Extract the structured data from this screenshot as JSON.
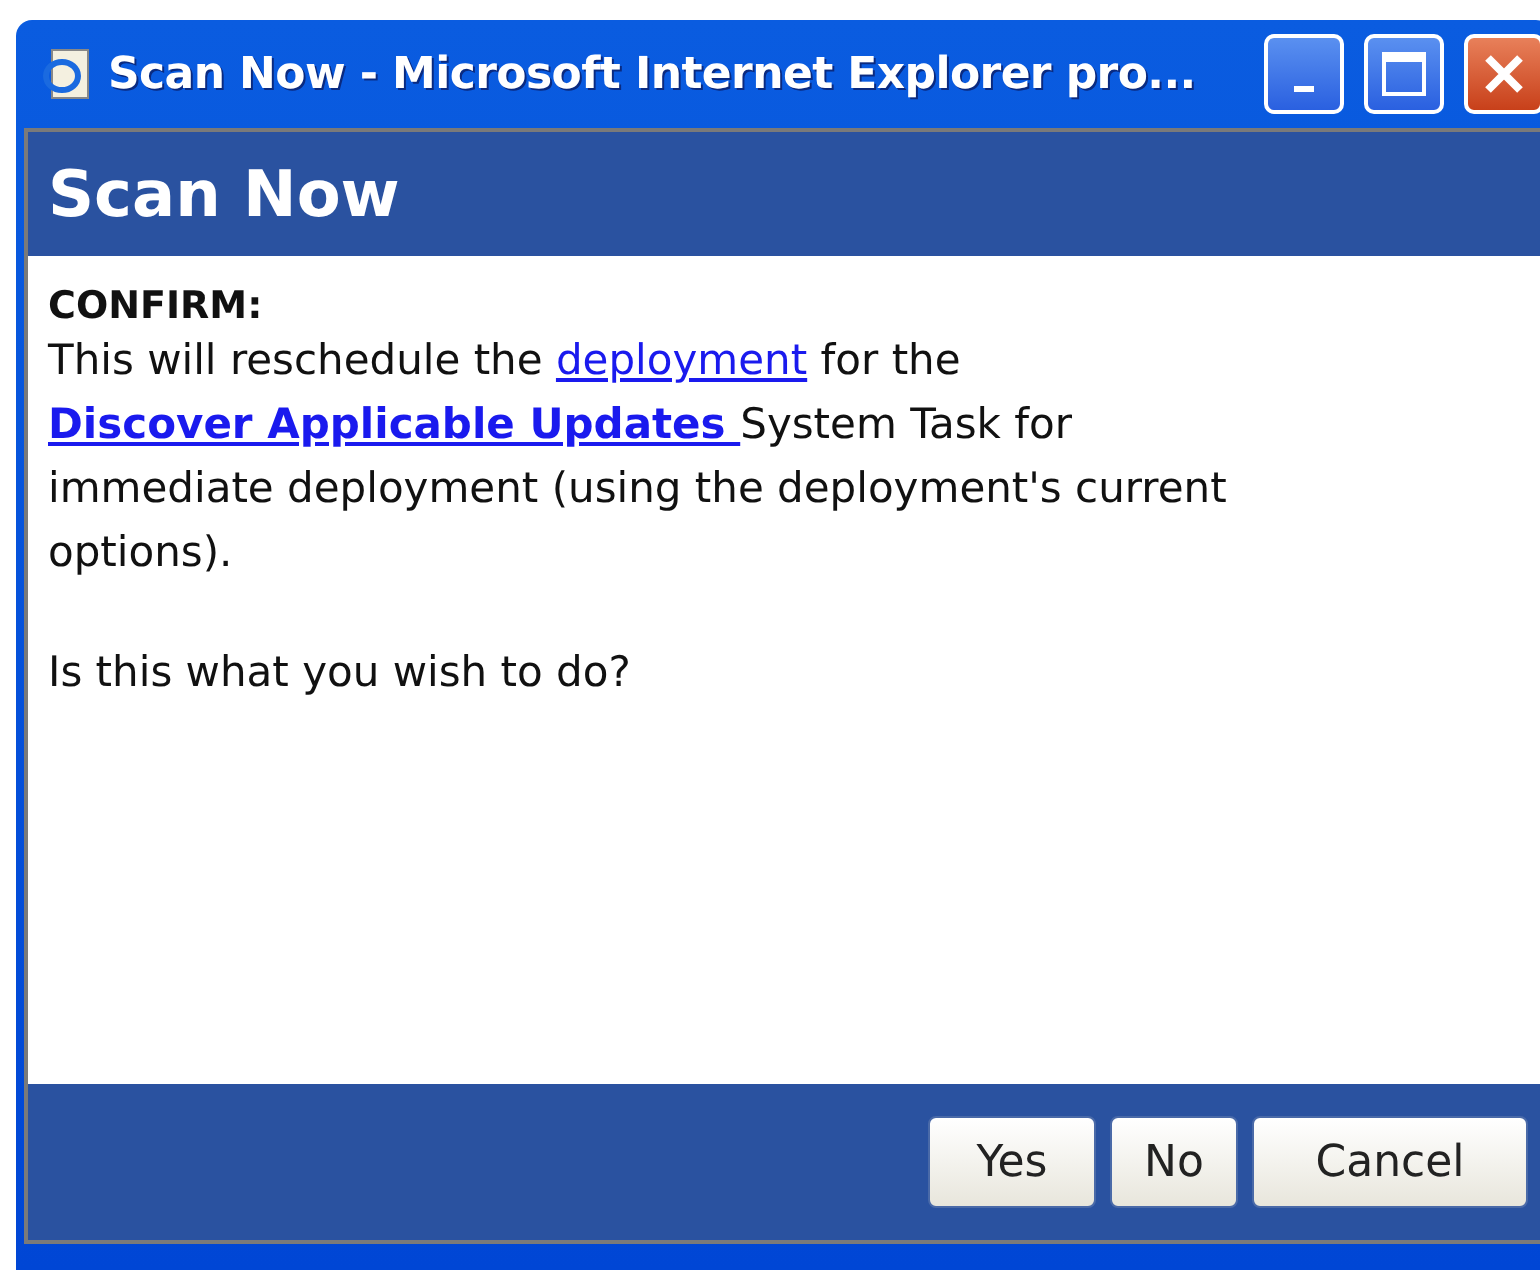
{
  "window": {
    "title": "Scan Now - Microsoft Internet Explorer pro..."
  },
  "header": {
    "title": "Scan Now"
  },
  "message": {
    "heading": "CONFIRM:",
    "parts": [
      {
        "kind": "text",
        "text": "This will reschedule the "
      },
      {
        "kind": "link",
        "text": "deployment"
      },
      {
        "kind": "text",
        "text": " for the "
      },
      {
        "kind": "strong-link",
        "text": "Discover Applicable Updates "
      },
      {
        "kind": "text",
        "text": "System Task for immediate deployment (using the deployment's current options)."
      }
    ],
    "question": "Is this what you wish to do?"
  },
  "buttons": [
    {
      "label": "Yes"
    },
    {
      "label": "No"
    },
    {
      "label": "Cancel"
    }
  ]
}
